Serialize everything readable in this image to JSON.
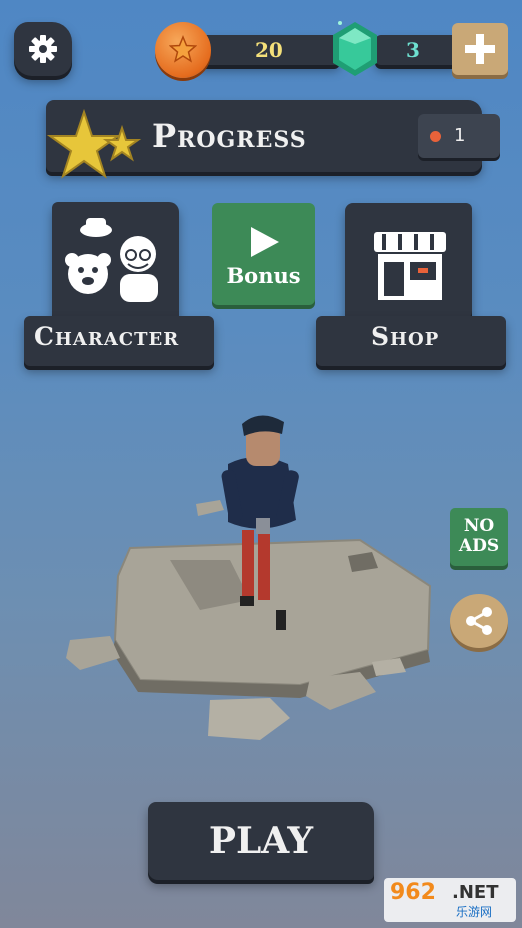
{
  "currency": {
    "coins": "20",
    "gems": "3"
  },
  "progress": {
    "label": "Progress",
    "count": "1"
  },
  "menu": {
    "character_label": "Character",
    "bonus_label": "Bonus",
    "shop_label": "Shop"
  },
  "side": {
    "noads_line1": "NO",
    "noads_line2": "ADS"
  },
  "play_label": "PLAY",
  "watermark": {
    "main": "962",
    "net": ".NET",
    "sub": "乐游网"
  },
  "icons": {
    "settings": "gear-icon",
    "coin": "star-coin-icon",
    "gem": "gem-icon",
    "add": "plus-icon",
    "progress": "stars-icon",
    "bonus": "play-icon",
    "shop": "storefront-icon",
    "share": "share-icon"
  },
  "colors": {
    "plank": "#2f3540",
    "green": "#3d8a57",
    "tan": "#c9a877",
    "coin": "#e56c1e",
    "gem": "#2fbf8e",
    "star": "#e7c63a"
  }
}
